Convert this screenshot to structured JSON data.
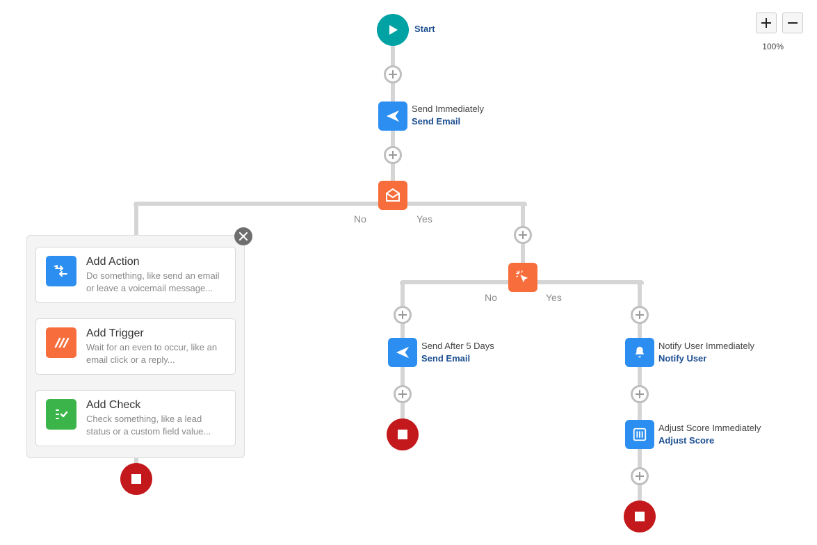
{
  "zoom": {
    "level": "100%"
  },
  "branch_labels": {
    "no": "No",
    "yes": "Yes"
  },
  "nodes": {
    "start": {
      "label": "Start"
    },
    "send_immediately": {
      "line1": "Send Immediately",
      "line2": "Send Email"
    },
    "send_after_5": {
      "line1": "Send After 5 Days",
      "line2": "Send Email"
    },
    "notify_user": {
      "line1": "Notify User Immediately",
      "line2": "Notify User"
    },
    "adjust_score": {
      "line1": "Adjust Score Immediately",
      "line2": "Adjust Score"
    }
  },
  "popup": {
    "add_action": {
      "title": "Add Action",
      "desc": "Do something, like send an email or leave a voicemail message..."
    },
    "add_trigger": {
      "title": "Add Trigger",
      "desc": "Wait for an even to occur, like an email click or a reply..."
    },
    "add_check": {
      "title": "Add Check",
      "desc": "Check something, like a lead status or a custom field value..."
    }
  }
}
